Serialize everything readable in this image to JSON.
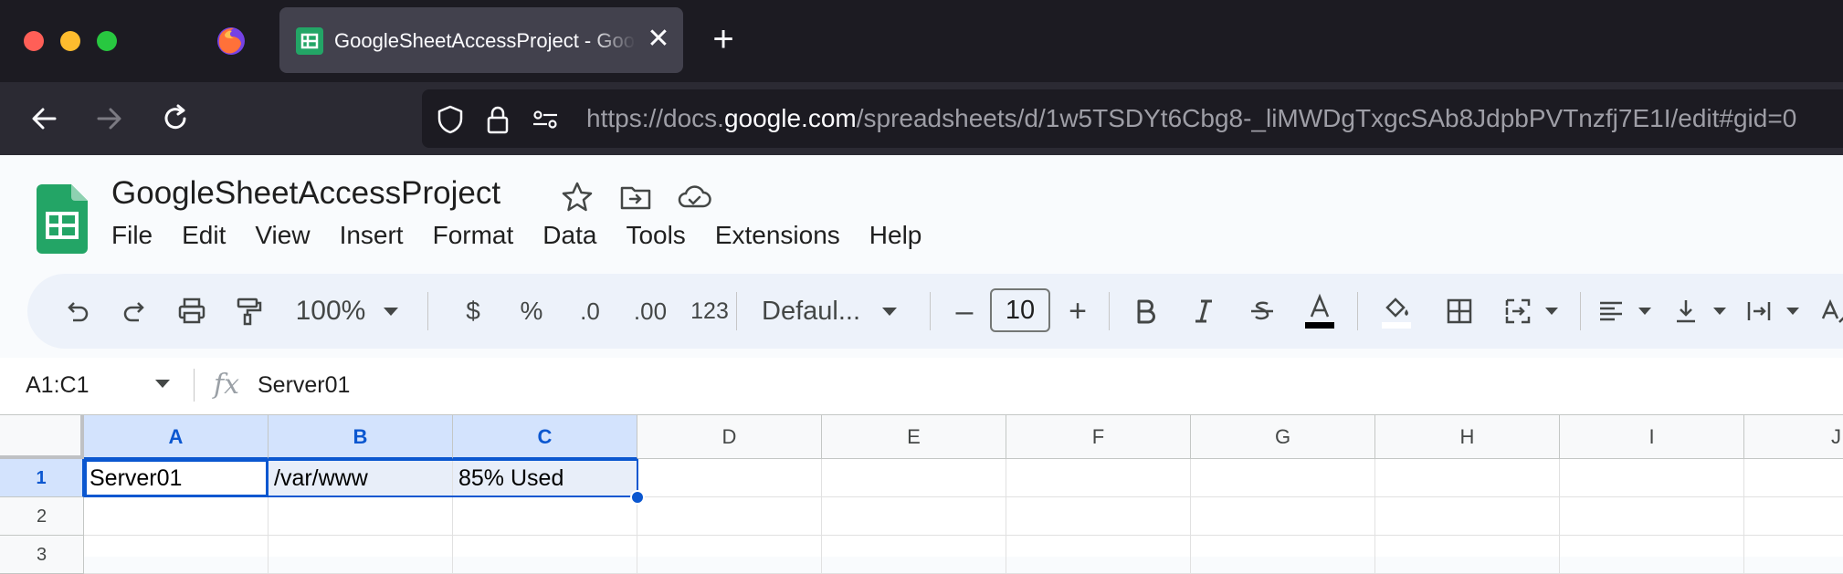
{
  "browser": {
    "tab_title": "GoogleSheetAccessProject - Google Sheets",
    "close_glyph": "✕",
    "new_tab_glyph": "+",
    "url_prefix": "https://docs.",
    "url_host": "google.com",
    "url_path": "/spreadsheets/d/1w5TSDYt6Cbg8-_liMWDgTxgcSAb8JdpbPVTnzfj7E1I/edit#gid=0",
    "icons": [
      "firefox-icon",
      "back-icon",
      "forward-icon",
      "reload-icon",
      "shield-icon",
      "lock-icon",
      "permissions-icon"
    ]
  },
  "sheets": {
    "doc_title": "GoogleSheetAccessProject",
    "menu": [
      "File",
      "Edit",
      "View",
      "Insert",
      "Format",
      "Data",
      "Tools",
      "Extensions",
      "Help"
    ],
    "toolbar": {
      "zoom": "100%",
      "currency": "$",
      "percent": "%",
      "decrease_decimal": ".0",
      "increase_decimal": ".00",
      "number_format": "123",
      "font": "Defaul...",
      "font_size": "10",
      "minus": "–",
      "plus": "+"
    },
    "formula_bar": {
      "name_box": "A1:C1",
      "fx": "fx",
      "value": "Server01"
    },
    "columns": [
      "A",
      "B",
      "C",
      "D",
      "E",
      "F",
      "G",
      "H",
      "I",
      "J"
    ],
    "rows": [
      "1",
      "2",
      "3"
    ],
    "cells": {
      "A1": "Server01",
      "B1": "/var/www",
      "C1": "85% Used"
    },
    "colors": {
      "accent": "#0b57d0",
      "selection_fill": "#d3e3fd",
      "sheets_green": "#23a566"
    }
  }
}
